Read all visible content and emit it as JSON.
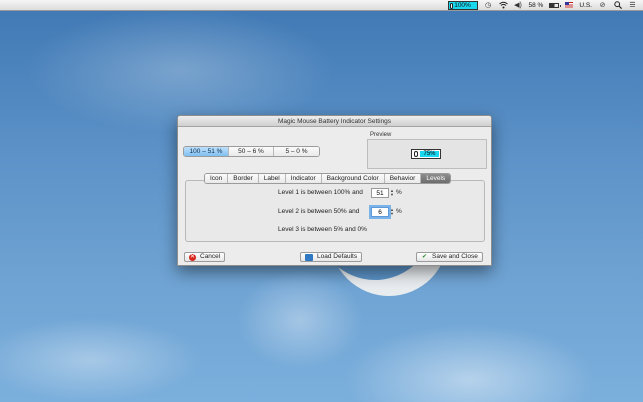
{
  "menubar": {
    "battery_percent": "100%",
    "battery_level_text": "58 %",
    "input_source": "U.S."
  },
  "dialog": {
    "title": "Magic Mouse Battery Indicator Settings",
    "ranges": [
      {
        "label": "100 – 51 %",
        "active": true
      },
      {
        "label": "50 – 6 %",
        "active": false
      },
      {
        "label": "5 – 0 %",
        "active": false
      }
    ],
    "preview_label": "Preview",
    "preview_value": "75%",
    "tabs": [
      {
        "label": "Icon",
        "active": false
      },
      {
        "label": "Border",
        "active": false
      },
      {
        "label": "Label",
        "active": false
      },
      {
        "label": "Indicator",
        "active": false
      },
      {
        "label": "Background Color",
        "active": false
      },
      {
        "label": "Behavior",
        "active": false
      },
      {
        "label": "Levels",
        "active": true
      }
    ],
    "levels": {
      "level1_text": "Level 1 is between 100% and",
      "level1_value": "51",
      "level2_text": "Level 2 is between  50%  and",
      "level2_value": "6",
      "level3_text": "Level 3 is between  5%    and 0%",
      "percent_sign": "%"
    },
    "buttons": {
      "cancel": "Cancel",
      "load_defaults": "Load Defaults",
      "save_close": "Save and Close"
    }
  },
  "colors": {
    "indicator_fill": "#19d7ef",
    "selected_segment": "#7fbff0",
    "active_tab": "#6c6c6c"
  }
}
